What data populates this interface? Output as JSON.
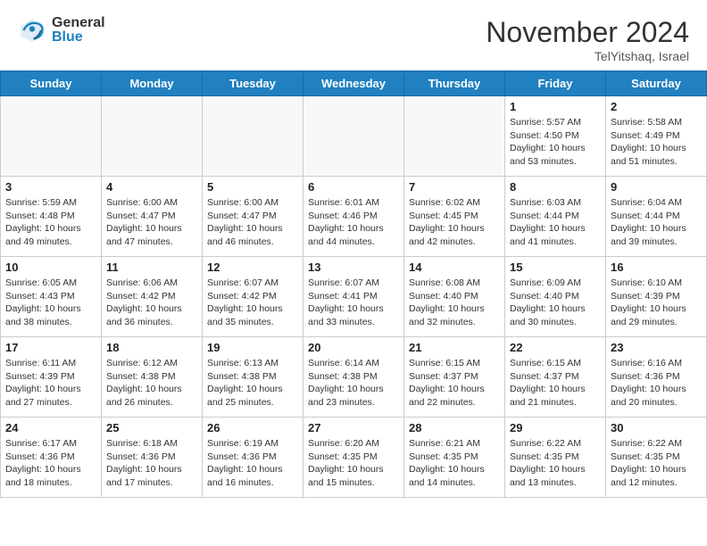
{
  "header": {
    "logo_general": "General",
    "logo_blue": "Blue",
    "month_title": "November 2024",
    "location": "TelYitshaq, Israel"
  },
  "calendar": {
    "days_of_week": [
      "Sunday",
      "Monday",
      "Tuesday",
      "Wednesday",
      "Thursday",
      "Friday",
      "Saturday"
    ],
    "weeks": [
      [
        {
          "day": "",
          "info": ""
        },
        {
          "day": "",
          "info": ""
        },
        {
          "day": "",
          "info": ""
        },
        {
          "day": "",
          "info": ""
        },
        {
          "day": "",
          "info": ""
        },
        {
          "day": "1",
          "info": "Sunrise: 5:57 AM\nSunset: 4:50 PM\nDaylight: 10 hours and 53 minutes."
        },
        {
          "day": "2",
          "info": "Sunrise: 5:58 AM\nSunset: 4:49 PM\nDaylight: 10 hours and 51 minutes."
        }
      ],
      [
        {
          "day": "3",
          "info": "Sunrise: 5:59 AM\nSunset: 4:48 PM\nDaylight: 10 hours and 49 minutes."
        },
        {
          "day": "4",
          "info": "Sunrise: 6:00 AM\nSunset: 4:47 PM\nDaylight: 10 hours and 47 minutes."
        },
        {
          "day": "5",
          "info": "Sunrise: 6:00 AM\nSunset: 4:47 PM\nDaylight: 10 hours and 46 minutes."
        },
        {
          "day": "6",
          "info": "Sunrise: 6:01 AM\nSunset: 4:46 PM\nDaylight: 10 hours and 44 minutes."
        },
        {
          "day": "7",
          "info": "Sunrise: 6:02 AM\nSunset: 4:45 PM\nDaylight: 10 hours and 42 minutes."
        },
        {
          "day": "8",
          "info": "Sunrise: 6:03 AM\nSunset: 4:44 PM\nDaylight: 10 hours and 41 minutes."
        },
        {
          "day": "9",
          "info": "Sunrise: 6:04 AM\nSunset: 4:44 PM\nDaylight: 10 hours and 39 minutes."
        }
      ],
      [
        {
          "day": "10",
          "info": "Sunrise: 6:05 AM\nSunset: 4:43 PM\nDaylight: 10 hours and 38 minutes."
        },
        {
          "day": "11",
          "info": "Sunrise: 6:06 AM\nSunset: 4:42 PM\nDaylight: 10 hours and 36 minutes."
        },
        {
          "day": "12",
          "info": "Sunrise: 6:07 AM\nSunset: 4:42 PM\nDaylight: 10 hours and 35 minutes."
        },
        {
          "day": "13",
          "info": "Sunrise: 6:07 AM\nSunset: 4:41 PM\nDaylight: 10 hours and 33 minutes."
        },
        {
          "day": "14",
          "info": "Sunrise: 6:08 AM\nSunset: 4:40 PM\nDaylight: 10 hours and 32 minutes."
        },
        {
          "day": "15",
          "info": "Sunrise: 6:09 AM\nSunset: 4:40 PM\nDaylight: 10 hours and 30 minutes."
        },
        {
          "day": "16",
          "info": "Sunrise: 6:10 AM\nSunset: 4:39 PM\nDaylight: 10 hours and 29 minutes."
        }
      ],
      [
        {
          "day": "17",
          "info": "Sunrise: 6:11 AM\nSunset: 4:39 PM\nDaylight: 10 hours and 27 minutes."
        },
        {
          "day": "18",
          "info": "Sunrise: 6:12 AM\nSunset: 4:38 PM\nDaylight: 10 hours and 26 minutes."
        },
        {
          "day": "19",
          "info": "Sunrise: 6:13 AM\nSunset: 4:38 PM\nDaylight: 10 hours and 25 minutes."
        },
        {
          "day": "20",
          "info": "Sunrise: 6:14 AM\nSunset: 4:38 PM\nDaylight: 10 hours and 23 minutes."
        },
        {
          "day": "21",
          "info": "Sunrise: 6:15 AM\nSunset: 4:37 PM\nDaylight: 10 hours and 22 minutes."
        },
        {
          "day": "22",
          "info": "Sunrise: 6:15 AM\nSunset: 4:37 PM\nDaylight: 10 hours and 21 minutes."
        },
        {
          "day": "23",
          "info": "Sunrise: 6:16 AM\nSunset: 4:36 PM\nDaylight: 10 hours and 20 minutes."
        }
      ],
      [
        {
          "day": "24",
          "info": "Sunrise: 6:17 AM\nSunset: 4:36 PM\nDaylight: 10 hours and 18 minutes."
        },
        {
          "day": "25",
          "info": "Sunrise: 6:18 AM\nSunset: 4:36 PM\nDaylight: 10 hours and 17 minutes."
        },
        {
          "day": "26",
          "info": "Sunrise: 6:19 AM\nSunset: 4:36 PM\nDaylight: 10 hours and 16 minutes."
        },
        {
          "day": "27",
          "info": "Sunrise: 6:20 AM\nSunset: 4:35 PM\nDaylight: 10 hours and 15 minutes."
        },
        {
          "day": "28",
          "info": "Sunrise: 6:21 AM\nSunset: 4:35 PM\nDaylight: 10 hours and 14 minutes."
        },
        {
          "day": "29",
          "info": "Sunrise: 6:22 AM\nSunset: 4:35 PM\nDaylight: 10 hours and 13 minutes."
        },
        {
          "day": "30",
          "info": "Sunrise: 6:22 AM\nSunset: 4:35 PM\nDaylight: 10 hours and 12 minutes."
        }
      ]
    ]
  }
}
